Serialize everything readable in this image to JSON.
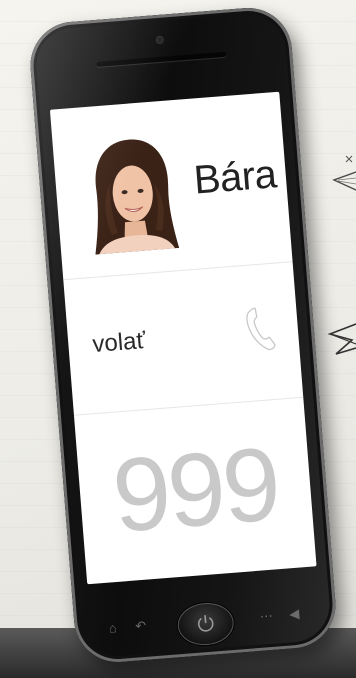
{
  "contact": {
    "name": "Bára"
  },
  "call": {
    "label": "volať",
    "icon": "phone-handset-icon"
  },
  "number": {
    "value": "999"
  },
  "softkeys": {
    "home_icon": "home-icon",
    "back_icon": "back-icon",
    "power_icon": "power-icon",
    "menu_icon": "menu-icon",
    "search_icon": "search-icon"
  },
  "colors": {
    "screen_bg": "#ffffff",
    "number_text": "#c9c9c9",
    "phone_body": "#111111",
    "paper": "#f1efe8"
  }
}
